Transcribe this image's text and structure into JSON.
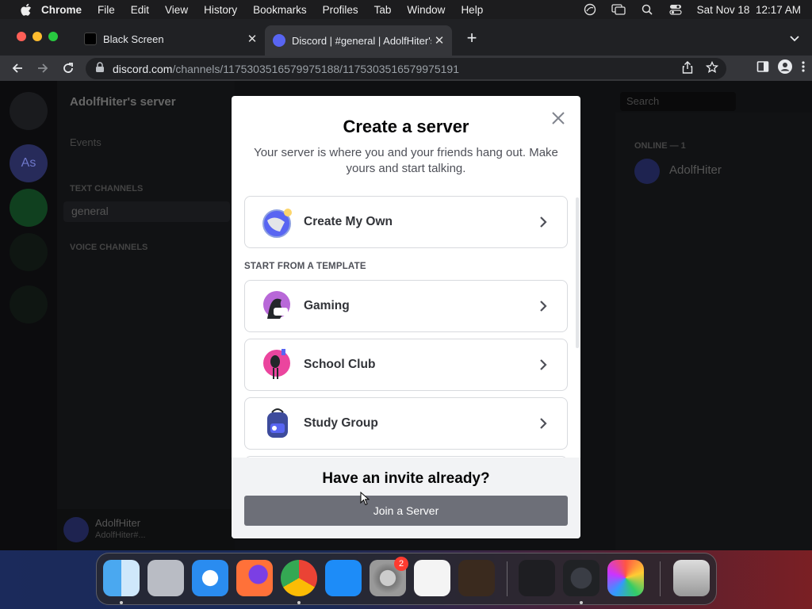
{
  "menubar": {
    "app": "Chrome",
    "items": [
      "File",
      "Edit",
      "View",
      "History",
      "Bookmarks",
      "Profiles",
      "Tab",
      "Window",
      "Help"
    ],
    "datetime": "Sat Nov 18  12:17 AM"
  },
  "tabs": [
    {
      "title": "Black Screen",
      "close": "✕"
    },
    {
      "title": "Discord | #general | AdolfHiter's",
      "close": "✕"
    }
  ],
  "newtab": "+",
  "address": {
    "domain": "discord.com",
    "path": "/channels/1175303516579975188/1175303516579975191"
  },
  "background": {
    "server_name": "AdolfHiter's server",
    "events": "Events",
    "text_channels": "TEXT CHANNELS",
    "channel": "general",
    "voice_channels": "VOICE CHANNELS",
    "search": "Search",
    "online": "ONLINE — 1",
    "member": "AdolfHiter",
    "user": "AdolfHiter",
    "user_sub": "AdolfHiter#...",
    "server_icon_text": "As"
  },
  "modal": {
    "title": "Create a server",
    "subtitle": "Your server is where you and your friends hang out. Make yours and start talking.",
    "create_own": "Create My Own",
    "template_label": "START FROM A TEMPLATE",
    "templates": [
      "Gaming",
      "School Club",
      "Study Group"
    ],
    "footer_title": "Have an invite already?",
    "join_button": "Join a Server"
  },
  "dock": {
    "badge": "2"
  }
}
